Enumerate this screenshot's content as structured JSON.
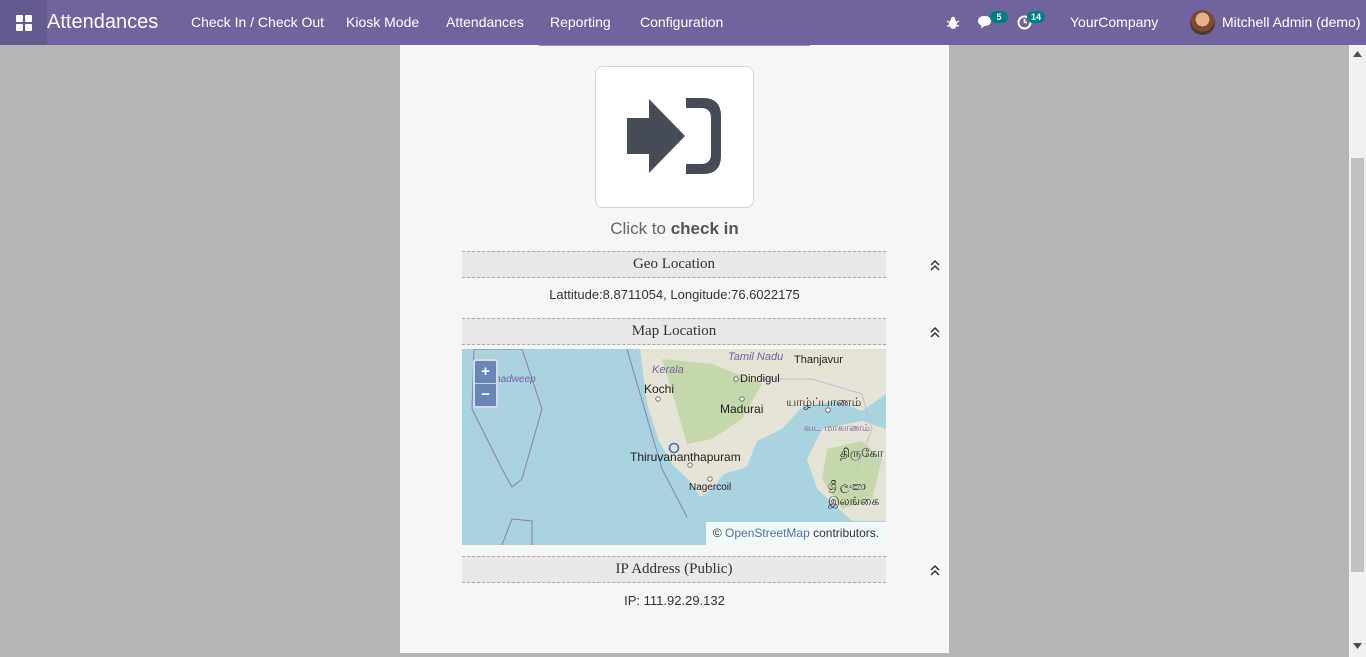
{
  "nav": {
    "app_title": "Attendances",
    "menu": [
      "Check In / Check Out",
      "Kiosk Mode",
      "Attendances",
      "Reporting",
      "Configuration"
    ],
    "messages_count": "5",
    "activities_count": "14",
    "company": "YourCompany",
    "user": "Mitchell Admin (demo)"
  },
  "checkin": {
    "prefix": "Click to",
    "action": "check in"
  },
  "geo": {
    "title": "Geo Location",
    "value": "Lattitude:8.8711054, Longitude:76.6022175"
  },
  "map": {
    "title": "Map Location",
    "zoom_in": "+",
    "zoom_out": "−",
    "attribution_prefix": "©",
    "attribution_link": "OpenStreetMap",
    "attribution_suffix": "contributors.",
    "labels": [
      "Tamil Nadu",
      "Thanjavur",
      "Kerala",
      "Kochi",
      "Dindigul",
      "Lakshadweep",
      "Madurai",
      "யாழ்ப்பாணம்",
      "வட மாகாணம்",
      "Thiruvananthapuram",
      "திருகோ",
      "Nagercoil",
      "ශ්‍රී ලංකා",
      "இலங்கை"
    ]
  },
  "ip": {
    "title": "IP Address (Public)",
    "value": "IP: 111.92.29.132"
  }
}
